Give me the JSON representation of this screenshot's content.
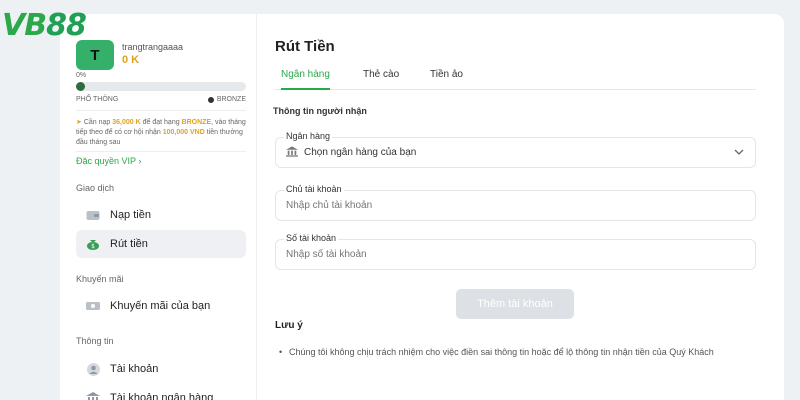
{
  "logo": {
    "part1": "V",
    "part2": "B",
    "part3": "88"
  },
  "user": {
    "avatar_letter": "T",
    "username": "trangtrangaaaa",
    "balance": "0 K",
    "progress_text": "0%",
    "progress_fraction": 0,
    "rank_current": "PHỔ THÔNG",
    "rank_next": "BRONZE",
    "promo_prefix": "Cần nạp",
    "promo_amount": "36,000 K",
    "promo_mid": "để đạt hạng",
    "promo_rank": "BRONZE",
    "promo_mid2": ", vào tháng tiếp theo để có cơ hội nhận",
    "promo_bonus": "100,000 VND",
    "promo_suffix": "tiền thưởng đầu tháng sau",
    "vip_link": "Đặc quyền VIP"
  },
  "sidebar": {
    "section_transactions": "Giao dịch",
    "deposit": "Nạp tiền",
    "withdraw": "Rút tiền",
    "section_promotions": "Khuyến mãi",
    "my_promotions": "Khuyến mãi của bạn",
    "section_info": "Thông tin",
    "account": "Tài khoản",
    "bank_account": "Tài khoản ngân hàng"
  },
  "main": {
    "title": "Rút Tiền",
    "tabs": [
      "Ngân hàng",
      "Thẻ cào",
      "Tiền ảo"
    ],
    "recipient_title": "Thông tin người nhận",
    "bank_label": "Ngân hàng",
    "bank_select_value": "Chọn ngân hàng của bạn",
    "holder_label": "Chủ tài khoản",
    "holder_placeholder": "Nhập chủ tài khoản",
    "number_label": "Số tài khoản",
    "number_placeholder": "Nhập số tài khoản",
    "add_button": "Thêm tài khoản",
    "note_title": "Lưu ý",
    "note_text": "Chúng tôi không chịu trách nhiệm cho việc điền sai thông tin hoặc để lộ thông tin nhận tiền của Quý Khách"
  },
  "colors": {
    "accent": "#2aa84a",
    "gold": "#e0a21d",
    "avatar": "#34b06b"
  },
  "icons": [
    "wallet-icon",
    "money-bag-icon",
    "ticket-icon",
    "user-icon",
    "bank-icon",
    "chevron-down-icon",
    "chevron-right-icon"
  ]
}
